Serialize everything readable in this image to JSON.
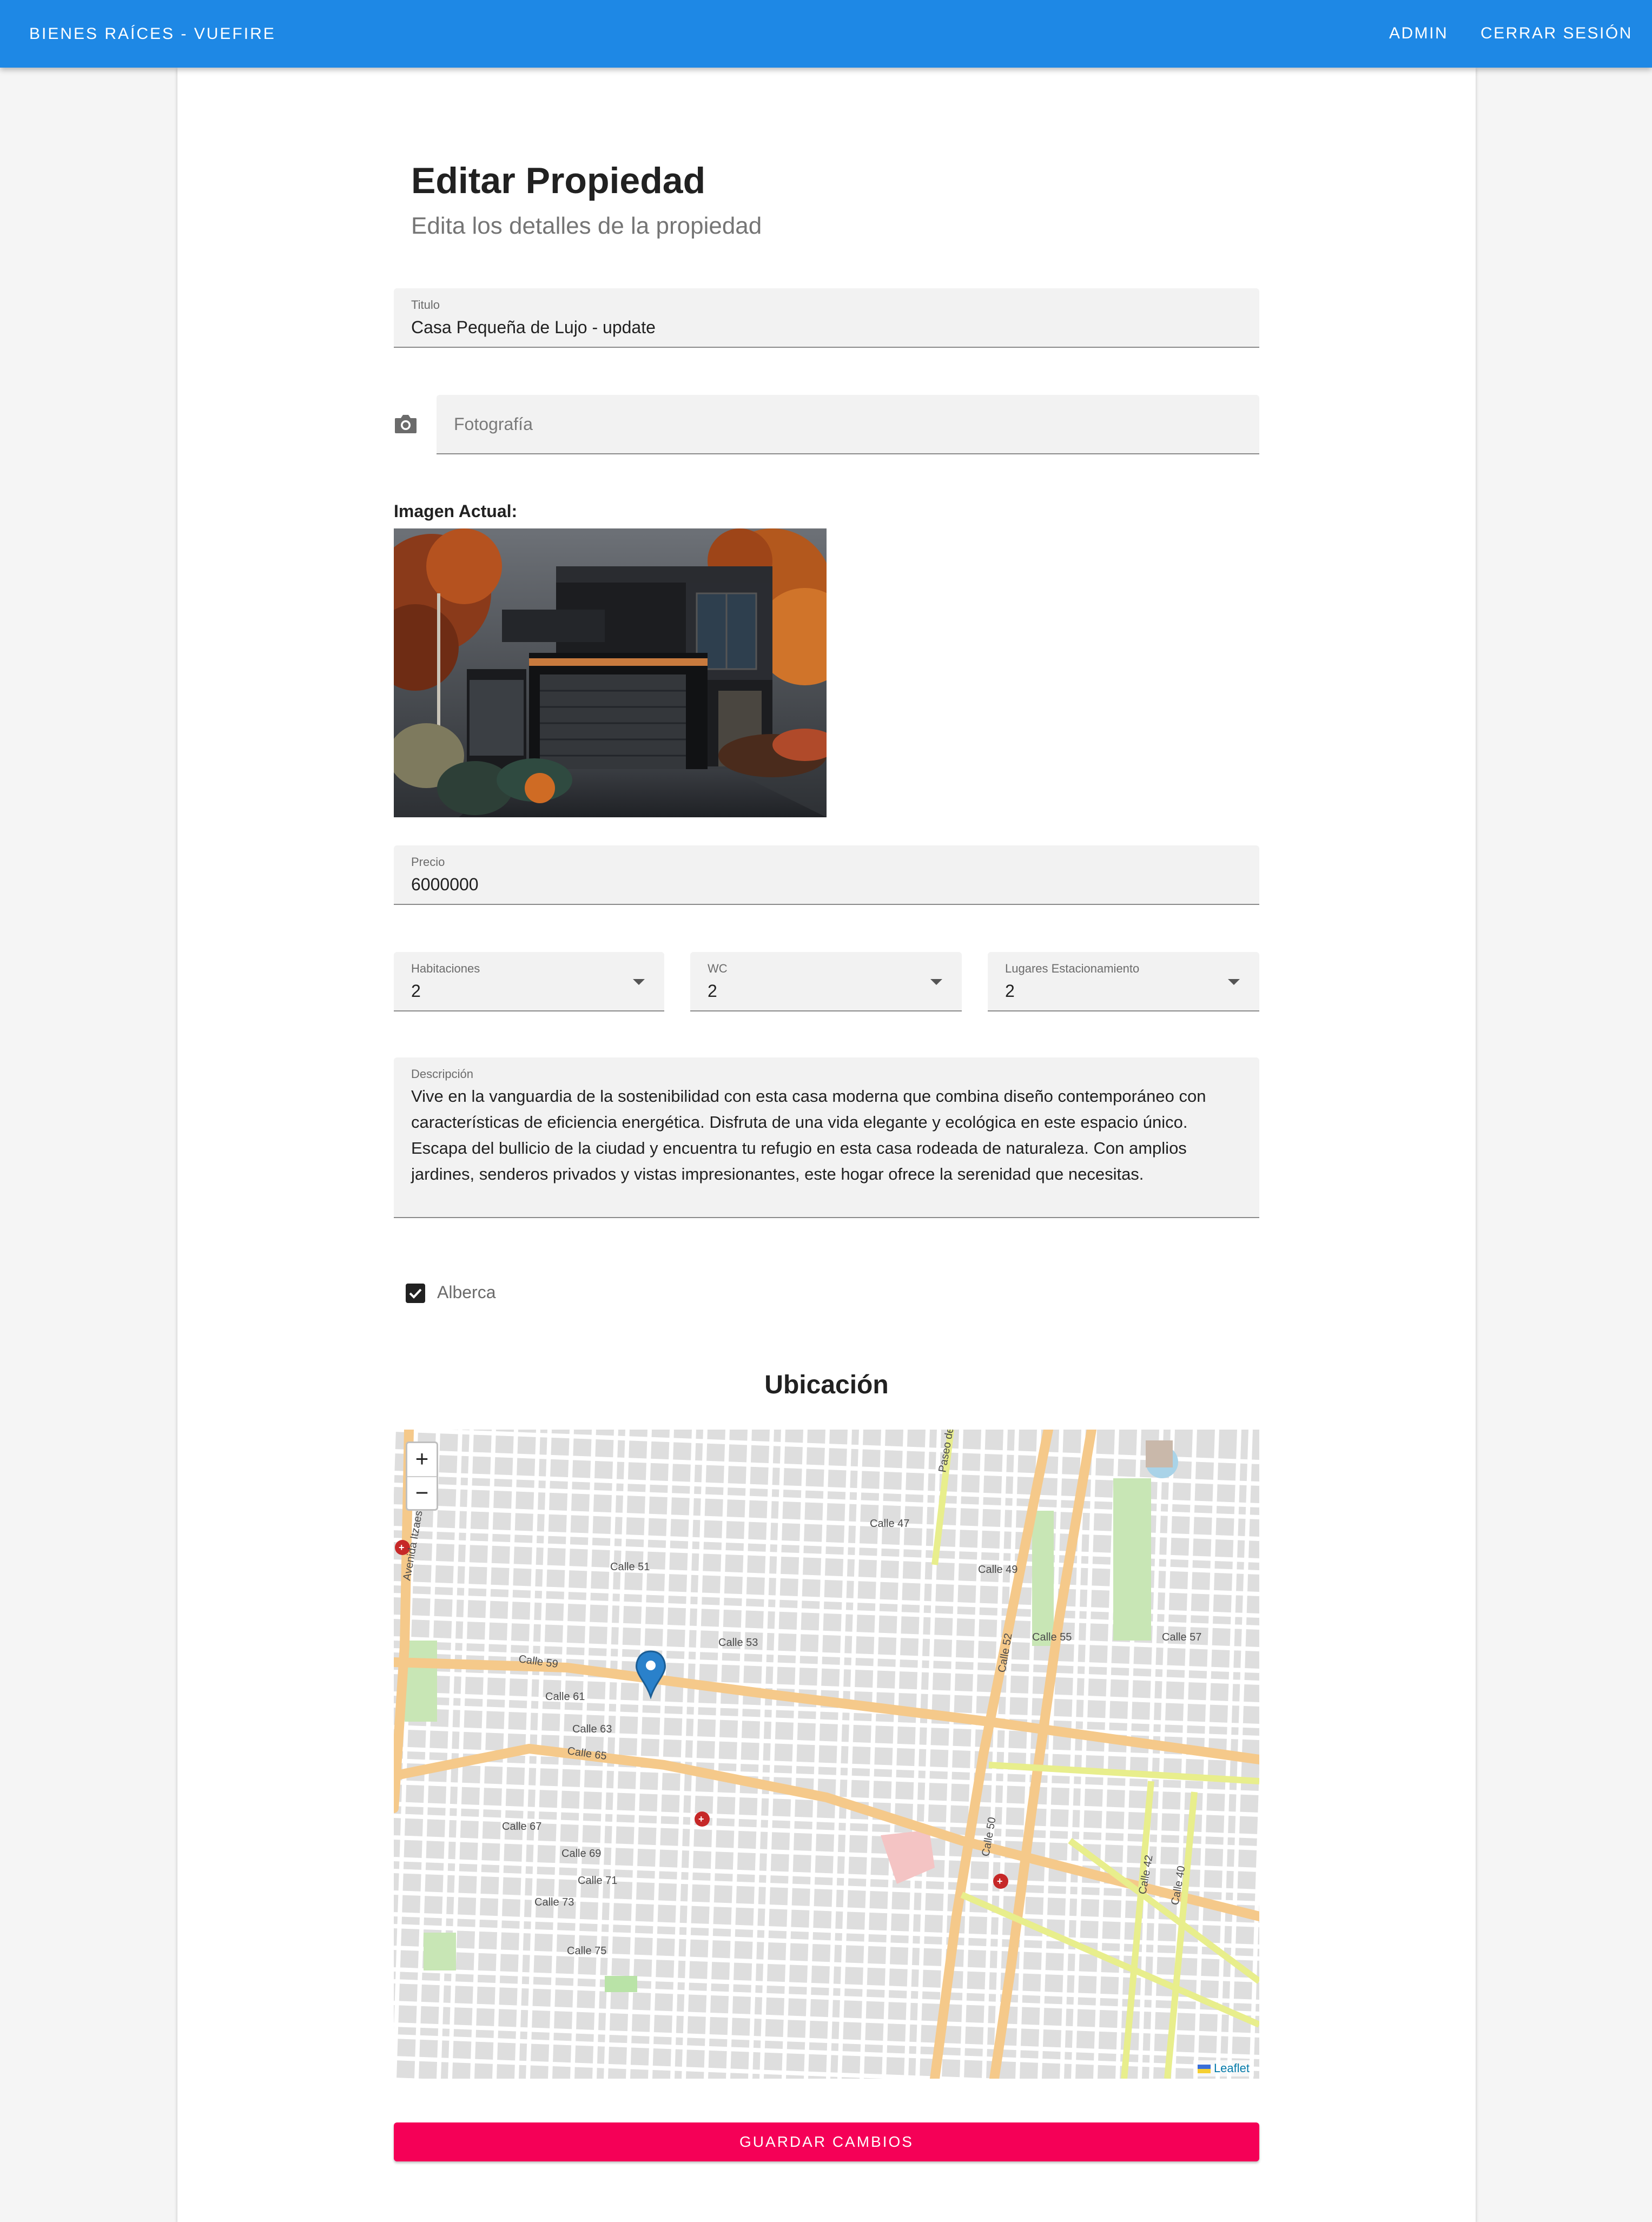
{
  "app": {
    "brand": "BIENES RAÍCES - VUEFIRE",
    "nav": {
      "admin": "ADMIN",
      "logout": "CERRAR SESIÓN"
    },
    "brand_color": "#1e88e5"
  },
  "page": {
    "title": "Editar Propiedad",
    "subtitle": "Edita los detalles de la propiedad"
  },
  "form": {
    "titulo": {
      "label": "Titulo",
      "value": "Casa Pequeña de Lujo - update"
    },
    "fotografia": {
      "placeholder": "Fotografía",
      "icon": "camera-icon"
    },
    "imagen_actual_label": "Imagen Actual:",
    "precio": {
      "label": "Precio",
      "value": "6000000"
    },
    "habitaciones": {
      "label": "Habitaciones",
      "value": "2"
    },
    "wc": {
      "label": "WC",
      "value": "2"
    },
    "estacionamiento": {
      "label": "Lugares Estacionamiento",
      "value": "2"
    },
    "descripcion": {
      "label": "Descripción",
      "value": "Vive en la vanguardia de la sostenibilidad con esta casa moderna que combina diseño contemporáneo con características de eficiencia energética. Disfruta de una vida elegante y ecológica en este espacio único.\nEscapa del bullicio de la ciudad y encuentra tu refugio en esta casa rodeada de naturaleza. Con amplios jardines, senderos privados y vistas impresionantes, este hogar ofrece la serenidad que necesitas."
    },
    "alberca": {
      "label": "Alberca",
      "checked": true
    },
    "submit": "GUARDAR CAMBIOS",
    "submit_color": "#f50057"
  },
  "map": {
    "title": "Ubicación",
    "zoom_in": "+",
    "zoom_out": "−",
    "attribution": "Leaflet",
    "labels": [
      "Calle 59",
      "Calle 65",
      "Calle 61",
      "Calle 63",
      "Calle 67",
      "Calle 69",
      "Calle 71",
      "Calle 73",
      "Calle 75",
      "Calle 47",
      "Calle 49",
      "Calle 51",
      "Calle 53",
      "Calle 55",
      "Calle 57",
      "Calle 52",
      "Calle 50",
      "Calle 42",
      "Calle 40",
      "Avenida Itzaes",
      "Paseo de Montejo"
    ]
  }
}
